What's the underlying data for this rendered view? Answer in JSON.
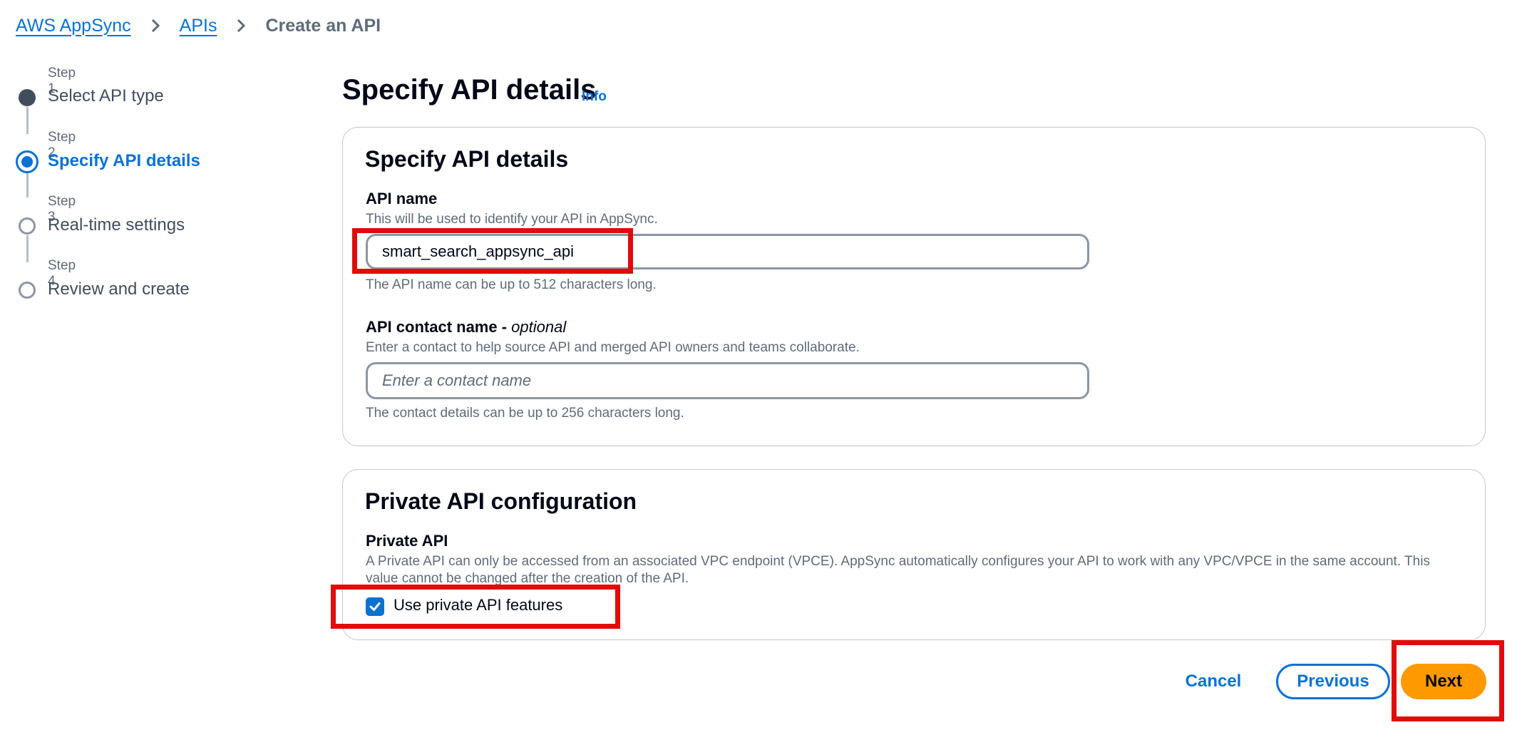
{
  "breadcrumb": {
    "items": [
      {
        "label": "AWS AppSync"
      },
      {
        "label": "APIs"
      },
      {
        "label": "Create an API"
      }
    ]
  },
  "steps": [
    {
      "number": "Step 1",
      "title": "Select API type",
      "state": "complete"
    },
    {
      "number": "Step 2",
      "title": "Specify API details",
      "state": "current"
    },
    {
      "number": "Step 3",
      "title": "Real-time settings",
      "state": "future"
    },
    {
      "number": "Step 4",
      "title": "Review and create",
      "state": "future"
    }
  ],
  "page": {
    "title": "Specify API details",
    "info_label": "Info"
  },
  "details": {
    "heading": "Specify API details",
    "api_name": {
      "label": "API name",
      "description": "This will be used to identify your API in AppSync.",
      "value": "smart_search_appsync_api",
      "constraint": "The API name can be up to 512 characters long."
    },
    "contact_name": {
      "label": "API contact name - ",
      "label_optional": "optional",
      "description": "Enter a contact to help source API and merged API owners and teams collaborate.",
      "placeholder": "Enter a contact name",
      "constraint": "The contact details can be up to 256 characters long."
    }
  },
  "private_config": {
    "heading": "Private API configuration",
    "label": "Private API",
    "description_line1": "A Private API can only be accessed from an associated VPC endpoint (VPCE). AppSync automatically configures your API to work with any VPC/VPCE in the same account. This",
    "description_line2": "value cannot be changed after the creation of the API.",
    "checkbox_label": "Use private API features",
    "checked": true
  },
  "actions": {
    "cancel": "Cancel",
    "previous": "Previous",
    "next": "Next"
  },
  "colors": {
    "link": "#0972d3",
    "primary_button": "#ff9900",
    "highlight": "#e10b0b"
  }
}
